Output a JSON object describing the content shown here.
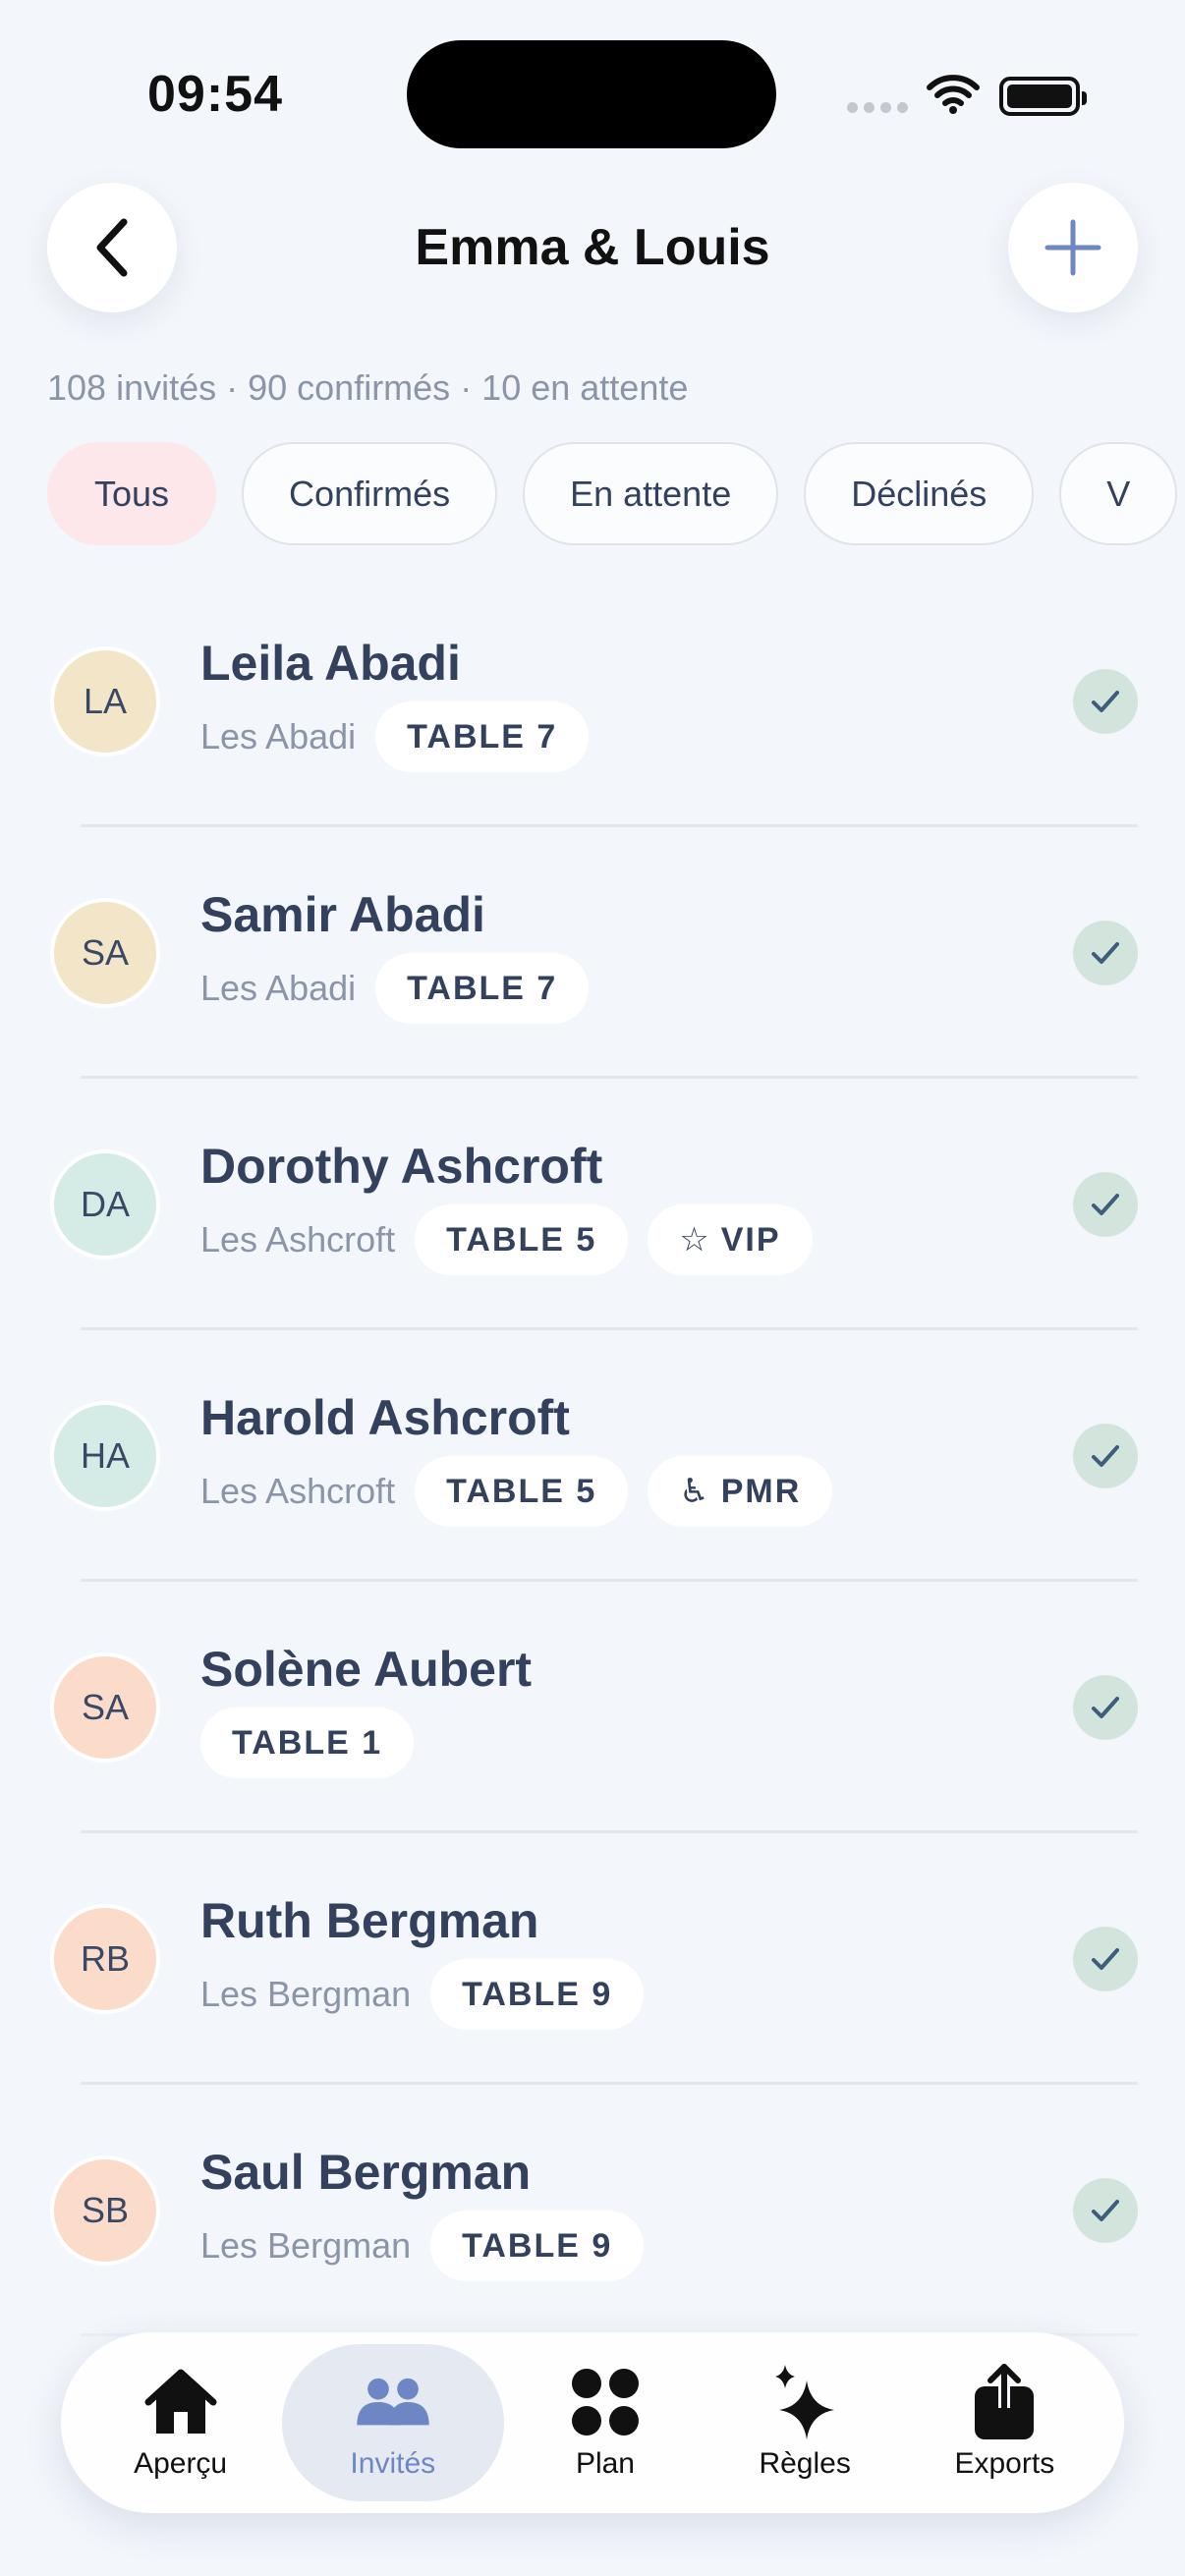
{
  "status_bar": {
    "time": "09:54"
  },
  "header": {
    "title": "Emma & Louis"
  },
  "summary": "108 invités · 90 confirmés · 10 en attente",
  "filters": [
    {
      "label": "Tous",
      "active": true
    },
    {
      "label": "Confirmés",
      "active": false
    },
    {
      "label": "En attente",
      "active": false
    },
    {
      "label": "Déclinés",
      "active": false
    },
    {
      "label": "V",
      "active": false
    }
  ],
  "guests": [
    {
      "initials": "LA",
      "name": "Leila Abadi",
      "household": "Les Abadi",
      "table": "TABLE 7",
      "extra": null,
      "avatar_color": "#f3e6c8",
      "status": "confirmed"
    },
    {
      "initials": "SA",
      "name": "Samir Abadi",
      "household": "Les Abadi",
      "table": "TABLE 7",
      "extra": null,
      "avatar_color": "#f3e6c8",
      "status": "confirmed"
    },
    {
      "initials": "DA",
      "name": "Dorothy Ashcroft",
      "household": "Les Ashcroft",
      "table": "TABLE 5",
      "extra": {
        "icon": "☆",
        "label": "VIP",
        "icon_name": "star-icon"
      },
      "avatar_color": "#d4ebe6",
      "status": "confirmed"
    },
    {
      "initials": "HA",
      "name": "Harold Ashcroft",
      "household": "Les Ashcroft",
      "table": "TABLE 5",
      "extra": {
        "icon": "♿",
        "label": "PMR",
        "icon_name": "wheelchair-icon"
      },
      "avatar_color": "#d4ebe6",
      "status": "confirmed"
    },
    {
      "initials": "SA",
      "name": "Solène Aubert",
      "household": "",
      "table": "TABLE 1",
      "extra": null,
      "avatar_color": "#fbdccb",
      "status": "confirmed"
    },
    {
      "initials": "RB",
      "name": "Ruth Bergman",
      "household": "Les Bergman",
      "table": "TABLE 9",
      "extra": null,
      "avatar_color": "#fbdccb",
      "status": "confirmed"
    },
    {
      "initials": "SB",
      "name": "Saul Bergman",
      "household": "Les Bergman",
      "table": "TABLE 9",
      "extra": null,
      "avatar_color": "#fbdccb",
      "status": "confirmed"
    }
  ],
  "tab_bar": [
    {
      "label": "Aperçu",
      "icon": "house-icon",
      "active": false
    },
    {
      "label": "Invités",
      "icon": "people-icon",
      "active": true
    },
    {
      "label": "Plan",
      "icon": "grid-dots-icon",
      "active": false
    },
    {
      "label": "Règles",
      "icon": "sparkles-icon",
      "active": false
    },
    {
      "label": "Exports",
      "icon": "share-icon",
      "active": false
    }
  ],
  "colors": {
    "accent": "#6d86c4",
    "active_chip": "#fde7ea",
    "check_bg": "#d3e4dc",
    "check_fg": "#3d5f7a"
  }
}
